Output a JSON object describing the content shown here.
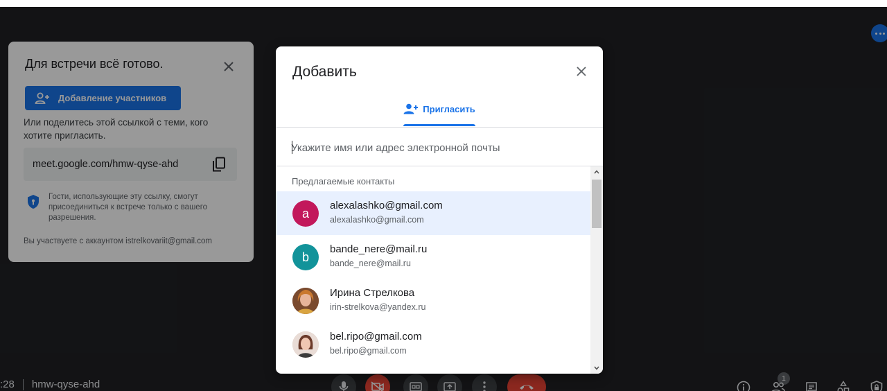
{
  "ready_card": {
    "title": "Для встречи всё готово.",
    "add_button_label": "Добавление участников",
    "share_text": "Или поделитесь этой ссылкой с теми, кого хотите пригласить.",
    "meeting_link": "meet.google.com/hmw-qyse-ahd",
    "guest_note": "Гости, использующие эту ссылку, смогут присоединиться к встрече только с вашего разрешения.",
    "account_note": "Вы участвуете с аккаунтом istrelkovariit@gmail.com"
  },
  "bottom_bar": {
    "time_fragment": ":28",
    "meeting_code": "hmw-qyse-ahd",
    "participants_count": "1",
    "accent_color": "#ea4335"
  },
  "dialog": {
    "title": "Добавить",
    "tab_label": "Пригласить",
    "search_placeholder": "Укажите имя или адрес электронной почты",
    "section_header": "Предлагаемые контакты",
    "contacts": [
      {
        "initial": "a",
        "name": "alexalashko@gmail.com",
        "email": "alexalashko@gmail.com",
        "avatar_color": "#c2185b",
        "highlighted": true
      },
      {
        "initial": "b",
        "name": "bande_nere@mail.ru",
        "email": "bande_nere@mail.ru",
        "avatar_color": "#12939a",
        "highlighted": false
      },
      {
        "initial": "",
        "name": "Ирина Стрелкова",
        "email": "irin-strelkova@yandex.ru",
        "avatar_color": "#8d5a3b",
        "highlighted": false
      },
      {
        "initial": "",
        "name": "bel.ripo@gmail.com",
        "email": "bel.ripo@gmail.com",
        "avatar_color": "#d9c3b8",
        "highlighted": false
      }
    ],
    "accent_color": "#1a73e8"
  }
}
